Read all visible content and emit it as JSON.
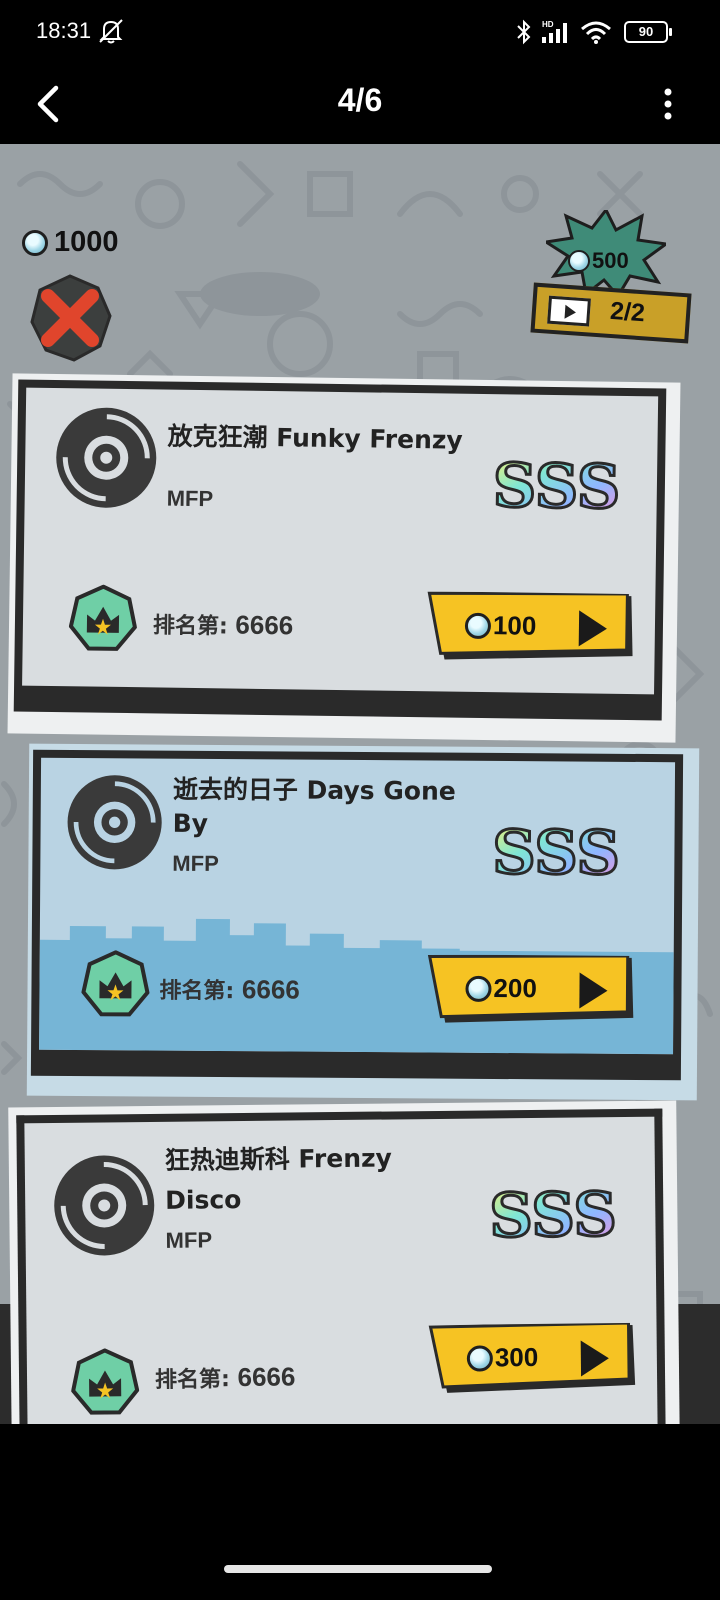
{
  "status_bar": {
    "time": "18:31",
    "network_label": "HD",
    "battery_level": "90"
  },
  "title_bar": {
    "title": "4/6"
  },
  "game": {
    "currency": "1000",
    "ad_reward": {
      "amount": "500",
      "count": "2/2"
    },
    "songs": [
      {
        "title_line1": "放克狂潮 Funky Frenzy",
        "title_line2": "",
        "artist": "MFP",
        "grade": "SSS",
        "rank_label": "排名第:",
        "rank_value": "6666",
        "cost": "100"
      },
      {
        "title_line1": "逝去的日子 Days Gone",
        "title_line2": "By",
        "artist": "MFP",
        "grade": "SSS",
        "rank_label": "排名第:",
        "rank_value": "6666",
        "cost": "200"
      },
      {
        "title_line1": "狂热迪斯科 Frenzy",
        "title_line2": "Disco",
        "artist": "MFP",
        "grade": "SSS",
        "rank_label": "排名第:",
        "rank_value": "6666",
        "cost": "300"
      }
    ]
  },
  "colors": {
    "background": "#9aa1a5",
    "card_light": "#d9dde0",
    "card_blue": "#b9d3e3",
    "card_blue_skyline": "#76b5d6",
    "button_yellow": "#f6c323",
    "rank_green": "#6fcfa6",
    "frame_dark": "#2a2a2a"
  },
  "icons": {
    "back": "chevron-left-icon",
    "more": "vertical-dots-icon",
    "close": "close-x-icon",
    "disc": "vinyl-disc-icon",
    "rank": "rank-badge-icon",
    "gem": "gem-icon",
    "video_ad": "video-play-icon"
  }
}
